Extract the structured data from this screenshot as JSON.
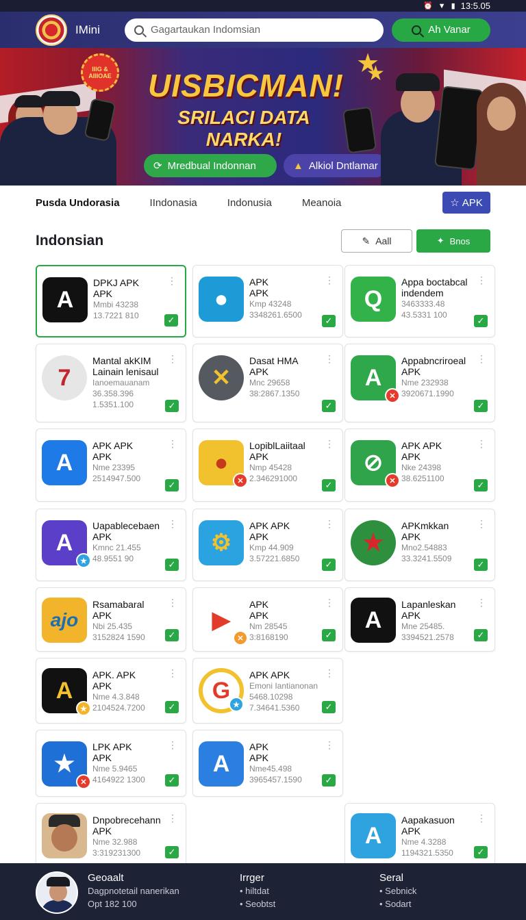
{
  "status_bar": {
    "time": "13:5.05"
  },
  "header": {
    "app_name": "IMini",
    "search_placeholder": "Gagartaukan Indomsian",
    "search_button": "Ah Vanar"
  },
  "banner": {
    "badge": "IIIG & AIIIOAE",
    "title": "UISBICMAN!",
    "subtitle": "SRILACI DATA NARKA!",
    "pill1": "Mredbual Indonnan",
    "pill2": "Alkiol Dntlamar"
  },
  "tabs": {
    "items": [
      "Pusda Undorasia",
      "IIndonasia",
      "Indonusia",
      "Meanoia"
    ],
    "apk_button": "APK"
  },
  "section": {
    "title": "Indonsian",
    "all_button": "Aall",
    "bns_button": "Bnos"
  },
  "apps": [
    {
      "name1": "DPKJ APK",
      "name2": "APK",
      "meta1": "Mmbi 43238",
      "meta2": "13.7221 810",
      "icon_bg": "#111111",
      "icon_glyph": "A"
    },
    {
      "name1": "APK",
      "name2": "APK",
      "meta1": "Kmp 43248",
      "meta2": "3348261.6500",
      "icon_bg": "#1c9bd6",
      "icon_glyph": "●"
    },
    {
      "name1": "Appa boctabcal",
      "name2": "indendem",
      "meta1": "3463333.48",
      "meta2": "43.5331 100",
      "icon_bg": "#33b24a",
      "icon_glyph": "Q"
    },
    {
      "name1": "Mantal akKIM",
      "name2": "Lainain lenisaul",
      "meta0": "Ianoemauanam",
      "meta1": "36.358.396",
      "meta2": "1.5351.100",
      "icon_bg": "#e6e6e6",
      "icon_glyph": "7"
    },
    {
      "name1": "Dasat HMA",
      "name2": "APK",
      "meta1": "Mnc 29658",
      "meta2": "38:2867.1350",
      "icon_bg": "#555a60",
      "icon_glyph": "✕"
    },
    {
      "name1": "Appabncriroeal",
      "name2": "APK",
      "meta1": "Nme 232938",
      "meta2": "3920671.1990",
      "icon_bg": "#2ea84a",
      "icon_glyph": "A"
    },
    {
      "name1": "APK APK",
      "name2": "APK",
      "meta1": "Nme 23395",
      "meta2": "2514947.500",
      "icon_bg": "#1e7ae6",
      "icon_glyph": "A"
    },
    {
      "name1": "LopiblLaiitaal",
      "name2": "APK",
      "meta1": "Nmp 45428",
      "meta2": "2.346291000",
      "icon_bg": "#f2c12e",
      "icon_glyph": "●"
    },
    {
      "name1": "APK APK",
      "name2": "APK",
      "meta1": "Nke 24398",
      "meta2": "38.6251100",
      "icon_bg": "#2fa44a",
      "icon_glyph": "⊘"
    },
    {
      "name1": "Uapablecebaen",
      "name2": "APK",
      "meta1": "Kmnc 21.455",
      "meta2": "48.9551 90",
      "icon_bg": "#5b3fc8",
      "icon_glyph": "A"
    },
    {
      "name1": "APK APK",
      "name2": "APK",
      "meta1": "Kmp 44.909",
      "meta2": "3.57221.6850",
      "icon_bg": "#2aa3e0",
      "icon_glyph": "⚙"
    },
    {
      "name1": "APKmkkan",
      "name2": "APK",
      "meta1": "Mno2.54883",
      "meta2": "33.3241.5509",
      "icon_bg": "#e9ecef",
      "icon_glyph": "★"
    },
    {
      "name1": "Rsamabaral",
      "name2": "APK",
      "meta1": "Nbi 25.435",
      "meta2": "3152824 1590",
      "icon_bg": "#f2b42a",
      "icon_glyph": "ajo"
    },
    {
      "name1": "APK",
      "name2": "APK",
      "meta1": "Nm 28545",
      "meta2": "3:8168190",
      "icon_bg": "#ffffff",
      "icon_glyph": "▶"
    },
    {
      "name1": "Lapanleskan",
      "name2": "APK",
      "meta1": "Mne 25485.",
      "meta2": "3394521.2578",
      "icon_bg": "#111111",
      "icon_glyph": "A"
    },
    {
      "name1": "APK. APK",
      "name2": "APK",
      "meta1": "Nme 4.3.848",
      "meta2": "2104524.7200",
      "icon_bg": "#111111",
      "icon_glyph": "A"
    },
    {
      "name1": "APK APK",
      "name2": "Emoni Iantianonan",
      "meta1": "5468.10298",
      "meta2": "7.34641.5360",
      "icon_bg": "#ffffff",
      "icon_glyph": "G"
    },
    {
      "name1": "LPK APK",
      "name2": "APK",
      "meta1": "Nme 5.9465",
      "meta2": "4164922 1300",
      "icon_bg": "#1e6fd6",
      "icon_glyph": "★"
    },
    {
      "name1": "APK",
      "name2": "APK",
      "meta1": "Nme45.498",
      "meta2": "3965457.1590",
      "icon_bg": "#2b7fe0",
      "icon_glyph": "A"
    },
    {
      "name1": "Dnpobrecehann",
      "name2": "APK",
      "meta1": "Nme 32.988",
      "meta2": "3:319231300",
      "icon_bg": "#d9b88f",
      "icon_glyph": ""
    },
    {
      "name1": "Aapakasuon",
      "name2": "APK",
      "meta1": "Nme 4.3288",
      "meta2": "1194321.5350",
      "icon_bg": "#2fa3e0",
      "icon_glyph": "A"
    }
  ],
  "footer": {
    "col1": {
      "title": "Geoaalt",
      "line1": "Dagpnotetail nanerikan",
      "line2": "Opt 182 100"
    },
    "col2": {
      "title": "Irrger",
      "line1": "• hiltdat",
      "line2": "• Seobtst"
    },
    "col3": {
      "title": "Seral",
      "line1": "• Sebnick",
      "line2": "• Sodart"
    }
  }
}
